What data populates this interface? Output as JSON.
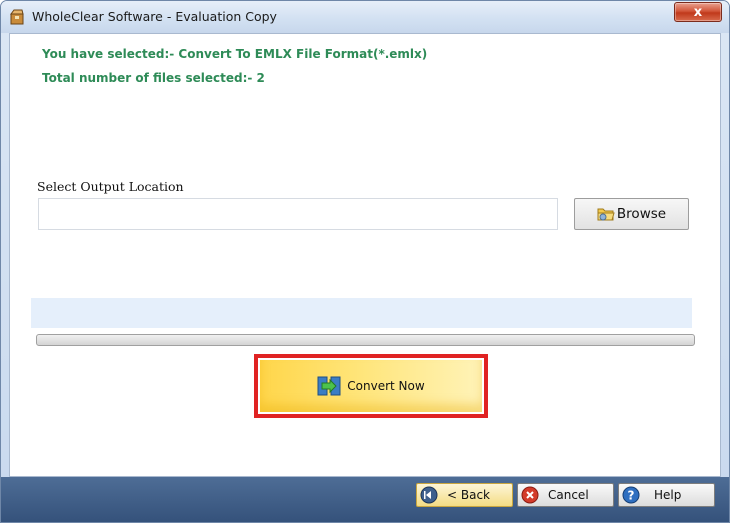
{
  "window": {
    "title": "WholeClear Software - Evaluation Copy",
    "close_glyph": "x"
  },
  "info": {
    "selected_format": "You have selected:- Convert To EMLX File Format(*.emlx)",
    "file_count": "Total number of files selected:- 2"
  },
  "output": {
    "label": "Select Output Location",
    "path_value": "",
    "browse_label": "Browse"
  },
  "progress": {
    "fraction": 0
  },
  "actions": {
    "convert_label": "Convert Now"
  },
  "footer": {
    "back_label": "< Back",
    "cancel_label": "Cancel",
    "help_label": "Help"
  },
  "colors": {
    "info_text": "#2e8b57",
    "highlight_border": "#e02323",
    "bottom_bar": "#35527b"
  },
  "icons": {
    "app": "software-box-icon",
    "browse": "folder-icon",
    "convert": "convert-arrow-icon",
    "back": "back-arrow-icon",
    "cancel": "cancel-icon",
    "help": "help-icon"
  }
}
